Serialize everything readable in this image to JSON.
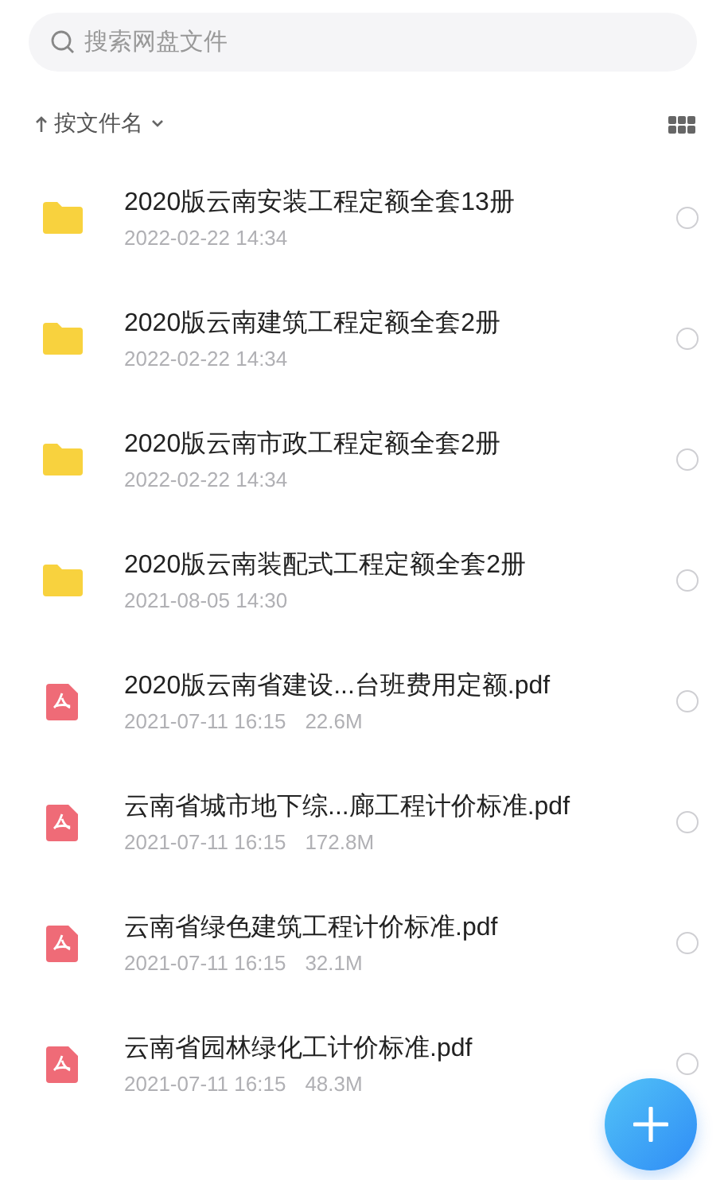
{
  "search": {
    "placeholder": "搜索网盘文件"
  },
  "sort": {
    "label": "按文件名"
  },
  "files": [
    {
      "kind": "folder",
      "name": "2020版云南安装工程定额全套13册",
      "date": "2022-02-22 14:34",
      "selected": false
    },
    {
      "kind": "folder",
      "name": "2020版云南建筑工程定额全套2册",
      "date": "2022-02-22 14:34",
      "selected": false
    },
    {
      "kind": "folder",
      "name": "2020版云南市政工程定额全套2册",
      "date": "2022-02-22 14:34",
      "selected": false
    },
    {
      "kind": "folder",
      "name": "2020版云南装配式工程定额全套2册",
      "date": "2021-08-05 14:30",
      "selected": false
    },
    {
      "kind": "pdf",
      "name": "2020版云南省建设...台班费用定额.pdf",
      "date": "2021-07-11 16:15",
      "size": "22.6M",
      "selected": false
    },
    {
      "kind": "pdf",
      "name": "云南省城市地下综...廊工程计价标准.pdf",
      "date": "2021-07-11 16:15",
      "size": "172.8M",
      "selected": false
    },
    {
      "kind": "pdf",
      "name": "云南省绿色建筑工程计价标准.pdf",
      "date": "2021-07-11 16:15",
      "size": "32.1M",
      "selected": false
    },
    {
      "kind": "pdf",
      "name": "云南省园林绿化工计价标准.pdf",
      "date": "2021-07-11 16:15",
      "size": "48.3M",
      "selected": false
    }
  ]
}
